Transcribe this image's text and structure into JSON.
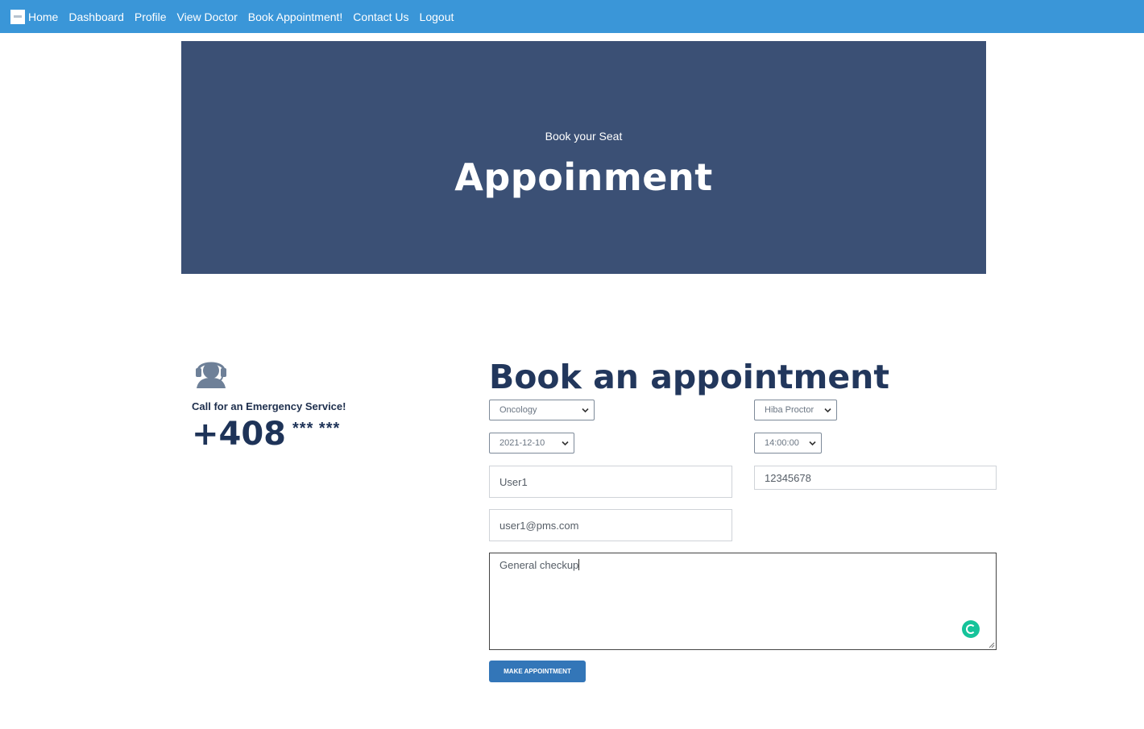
{
  "nav": {
    "logo_icon": "site-logo-icon",
    "links": [
      "Home",
      "Dashboard",
      "Profile",
      "View Doctor",
      "Book Appointment!",
      "Contact Us",
      "Logout"
    ]
  },
  "hero": {
    "subtitle": "Book your Seat",
    "title": "Appoinment"
  },
  "emergency": {
    "icon": "headset-agent-icon",
    "label": "Call for an Emergency Service!",
    "phone_prefix": "+408",
    "phone_masked": "*** ***"
  },
  "form": {
    "title": "Book an appointment",
    "department": "Oncology",
    "doctor": "Hiba Proctor",
    "date": "2021-12-10",
    "time": "14:00:00",
    "name": "User1",
    "phone": "12345678",
    "email": "user1@pms.com",
    "message": "General checkup",
    "submit_label": "Make Appointment"
  },
  "colors": {
    "navbar": "#3a96d8",
    "hero_bg": "#3b5075",
    "heading": "#22375c",
    "button": "#3376b8",
    "grammarly": "#15c39a"
  }
}
